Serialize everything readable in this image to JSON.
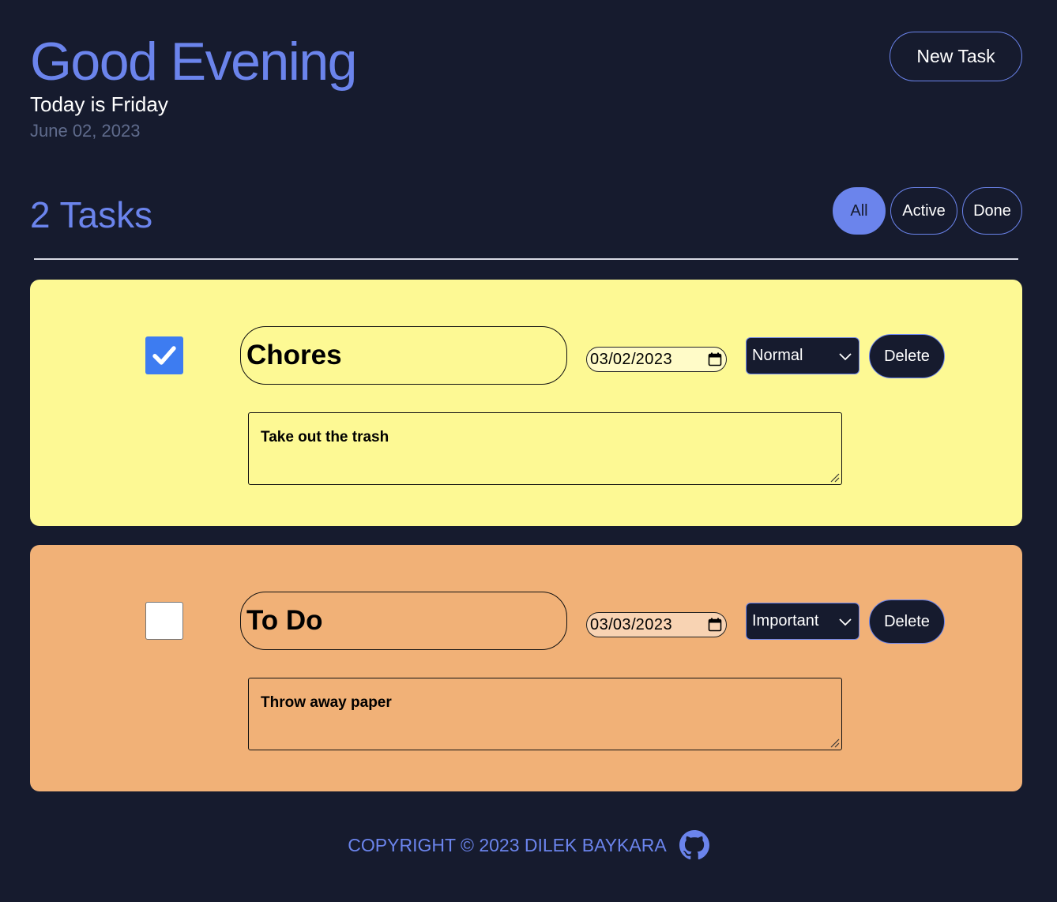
{
  "header": {
    "greeting": "Good Evening",
    "subtitle": "Today is Friday",
    "date": "June 02, 2023",
    "new_task_label": "New Task"
  },
  "summary": {
    "task_count": "2 Tasks",
    "filters": [
      {
        "label": "All",
        "active": true
      },
      {
        "label": "Active",
        "active": false
      },
      {
        "label": "Done",
        "active": false
      }
    ]
  },
  "tasks": [
    {
      "checked": true,
      "title": "Chores",
      "date": {
        "month": "03",
        "day": "02",
        "year": "2023"
      },
      "priority": "Normal",
      "delete_label": "Delete",
      "description": "Take out the trash",
      "color": "#fdf994"
    },
    {
      "checked": false,
      "title": "To Do",
      "date": {
        "month": "03",
        "day": "03",
        "year": "2023"
      },
      "priority": "Important",
      "delete_label": "Delete",
      "description": "Throw away paper",
      "color": "#f1b177"
    }
  ],
  "footer": {
    "copyright": "COPYRIGHT © 2023 DILEK BAYKARA",
    "icon": "github-icon"
  },
  "colors": {
    "background": "#161b2e",
    "accent": "#6b84ec",
    "checkbox": "#3d7cf1"
  }
}
